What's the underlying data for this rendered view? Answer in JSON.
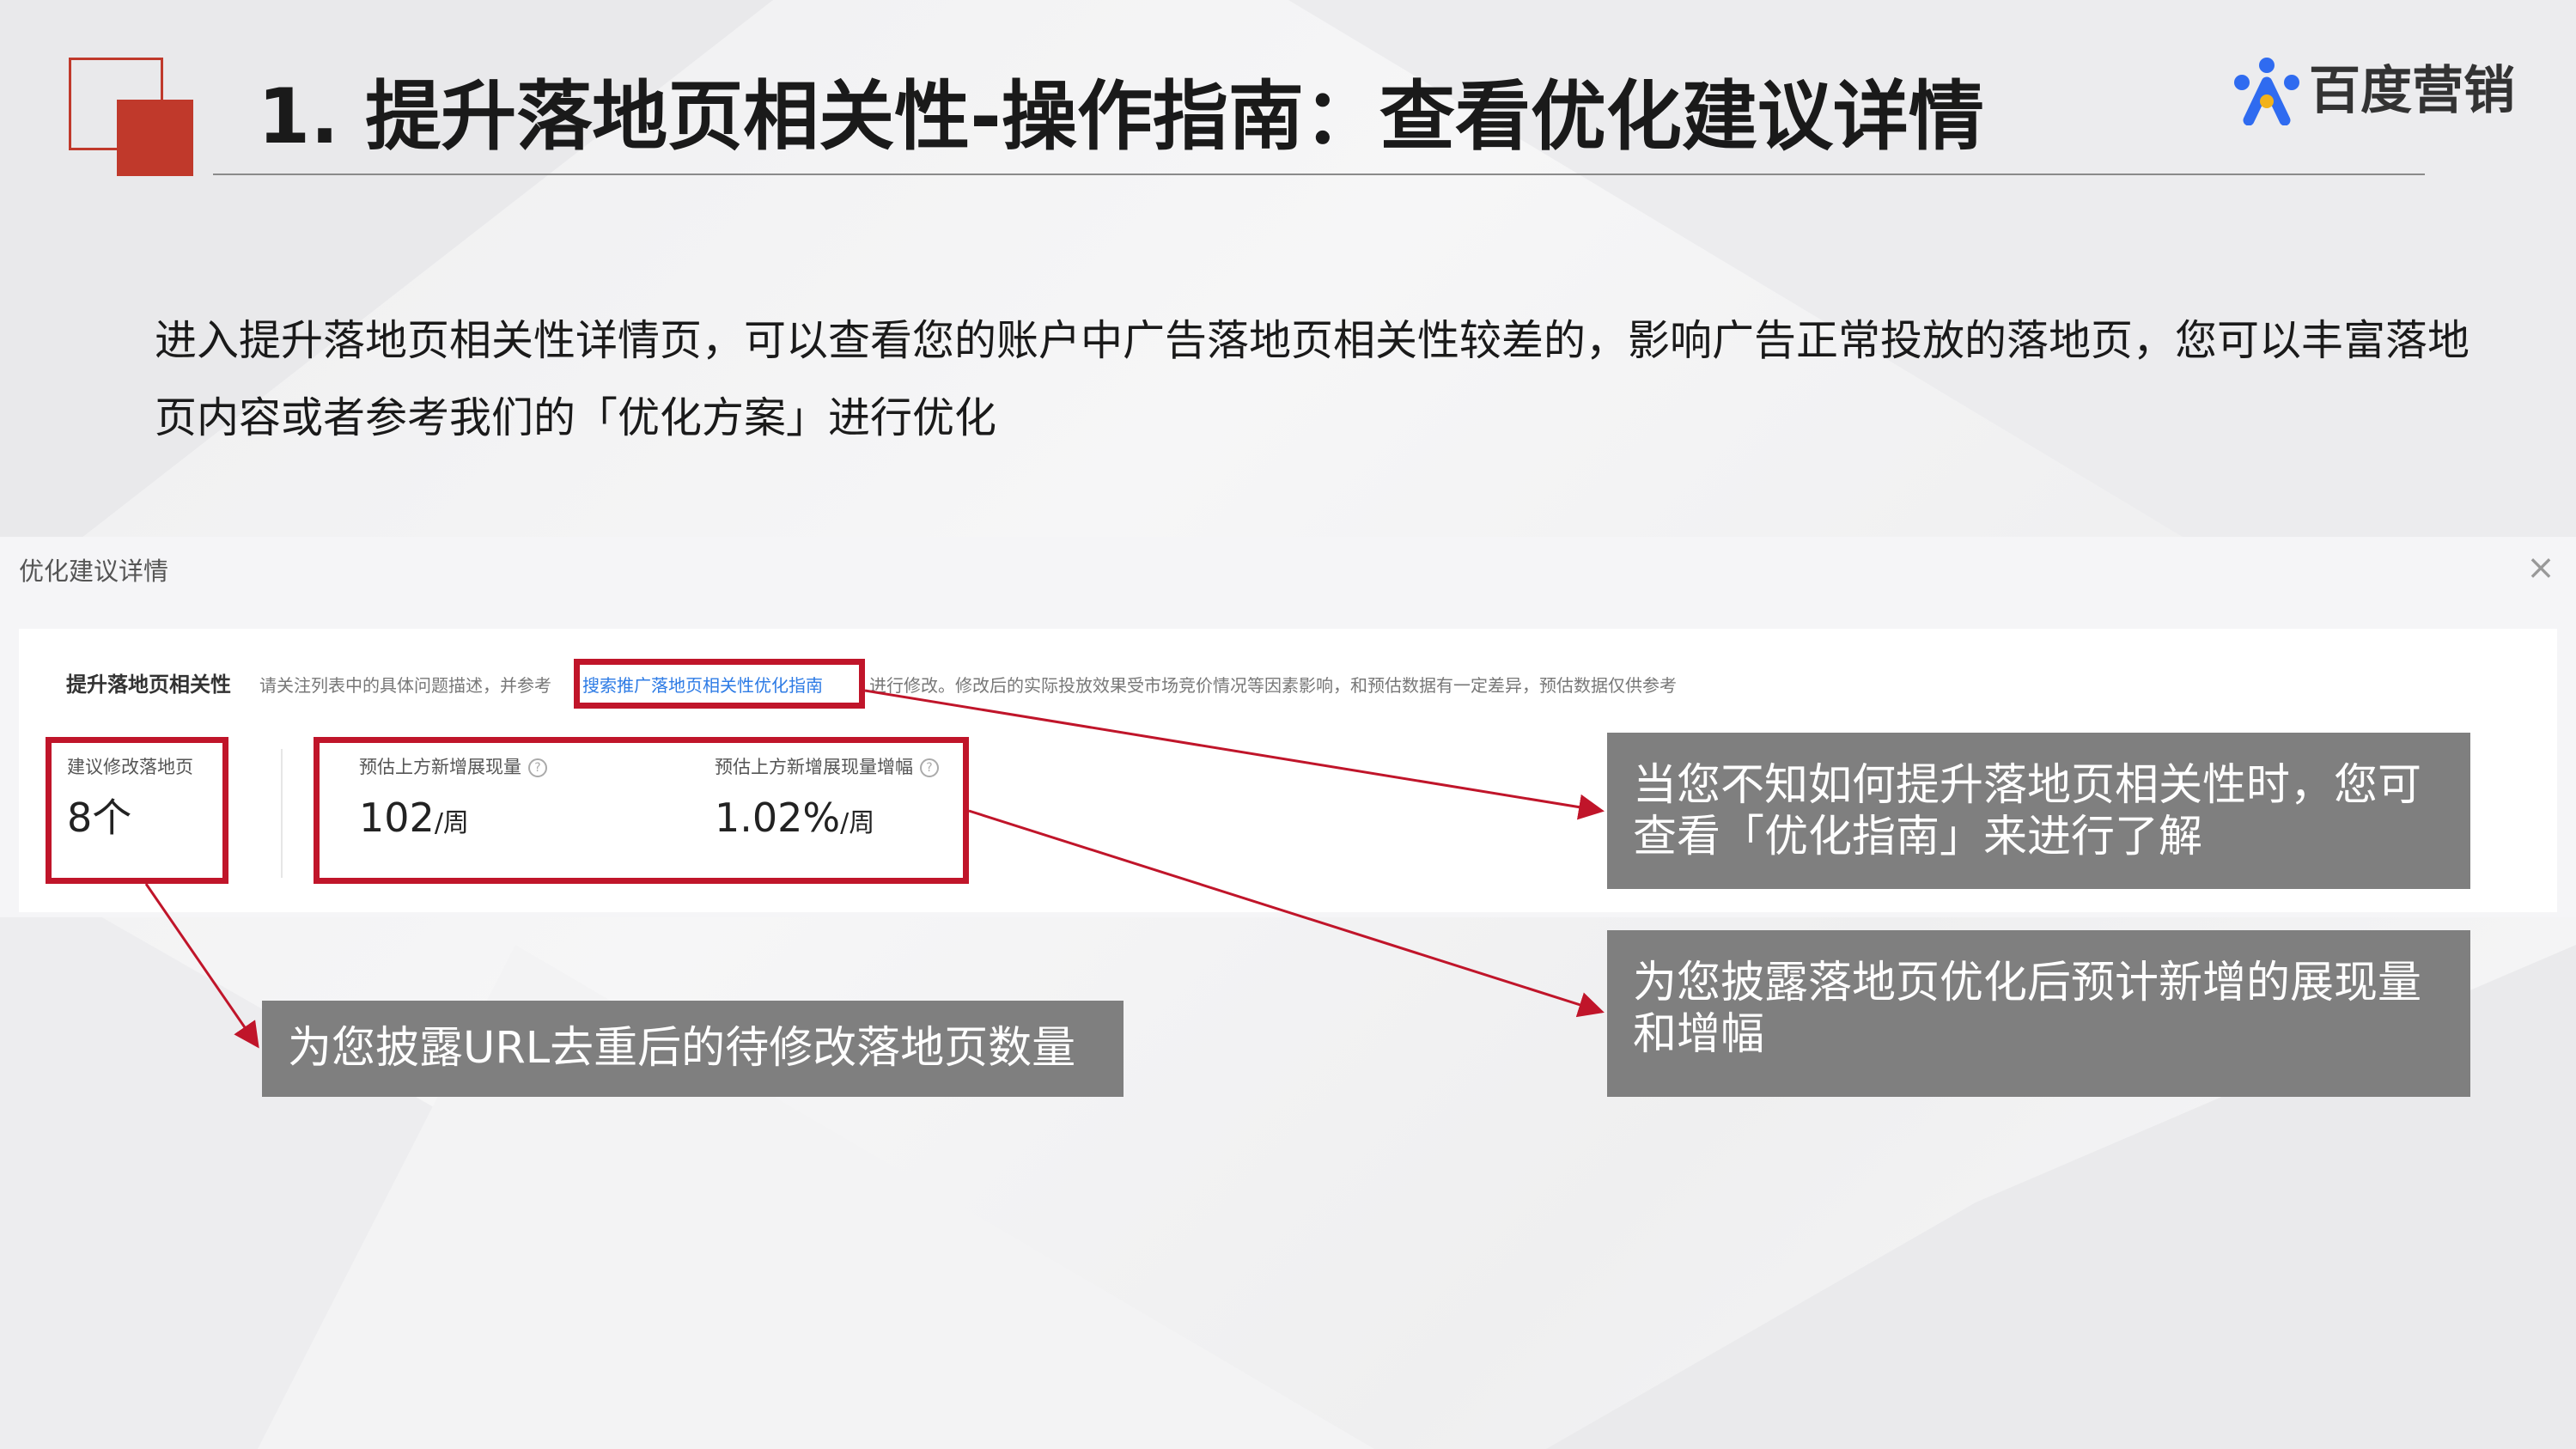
{
  "header": {
    "title": "1. 提升落地页相关性-操作指南：查看优化建议详情",
    "brand": "百度营销"
  },
  "intro": "进入提升落地页相关性详情页，可以查看您的账户中广告落地页相关性较差的，影响广告正常投放的落地页，您可以丰富落地页内容或者参考我们的「优化方案」进行优化",
  "panel": {
    "title": "优化建议详情",
    "close_glyph": "×",
    "heading": "提升落地页相关性",
    "desc_before": "请关注列表中的具体问题描述，并参考",
    "guide_link": "搜索推广落地页相关性优化指南",
    "desc_after": "进行修改。修改后的实际投放效果受市场竞价情况等因素影响，和预估数据有一定差异，预估数据仅供参考",
    "stats": [
      {
        "label": "建议修改落地页",
        "value": "8个",
        "unit": ""
      },
      {
        "label": "预估上方新增展现量",
        "value": "102",
        "unit": "/周"
      },
      {
        "label": "预估上方新增展现量增幅",
        "value": "1.02%",
        "unit": "/周"
      }
    ]
  },
  "callouts": {
    "guide": "当您不知如何提升落地页相关性时，您可查看「优化指南」来进行了解",
    "impressions": "为您披露落地页优化后预计新增的展现量和增幅",
    "pages": "为您披露URL去重后的待修改落地页数量"
  },
  "colors": {
    "accent_red": "#c0152a",
    "link_blue": "#2d7be5",
    "callout_gray": "#7f7f7f"
  }
}
